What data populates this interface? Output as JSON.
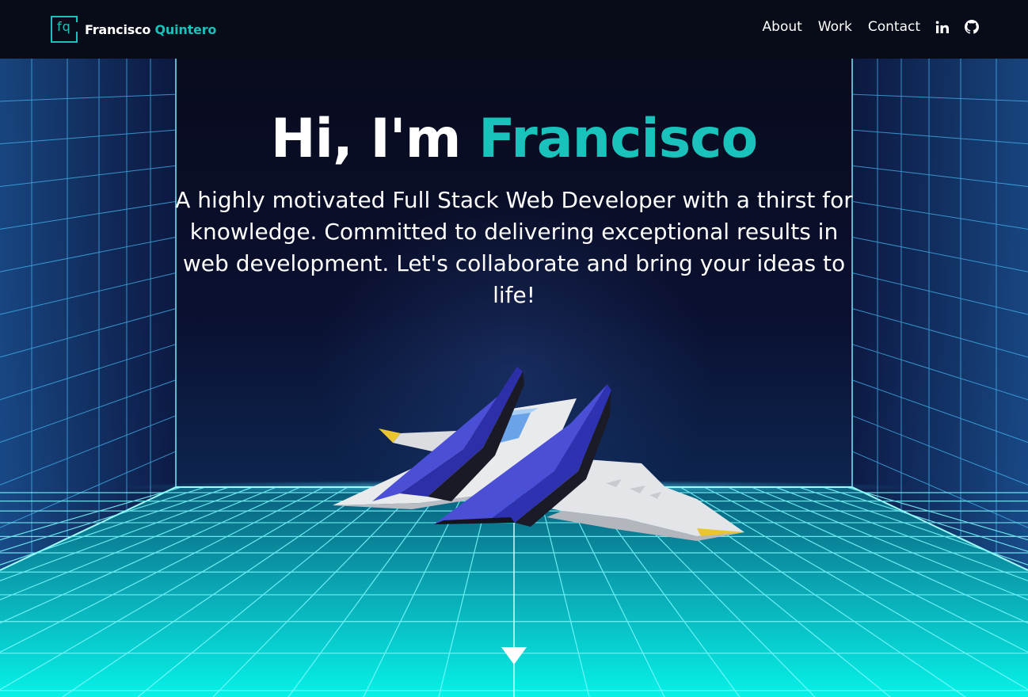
{
  "header": {
    "logo_text": "fq",
    "brand_first": "Francisco",
    "brand_last": "Quintero",
    "nav": {
      "about": "About",
      "work": "Work",
      "contact": "Contact"
    },
    "icons": {
      "linkedin": "linkedin-icon",
      "github": "github-icon"
    }
  },
  "hero": {
    "greeting": "Hi, I'm",
    "name": "Francisco",
    "subtitle": "A highly motivated Full Stack Web Developer with a thirst for knowledge. Committed to delivering exceptional results in web development. Let's collaborate and bring your ideas to life!"
  },
  "icons": {
    "scroll": "chevron-down-icon"
  },
  "colors": {
    "accent": "#19c2ba",
    "background": "#080b18",
    "grid": "#1de9f0"
  }
}
